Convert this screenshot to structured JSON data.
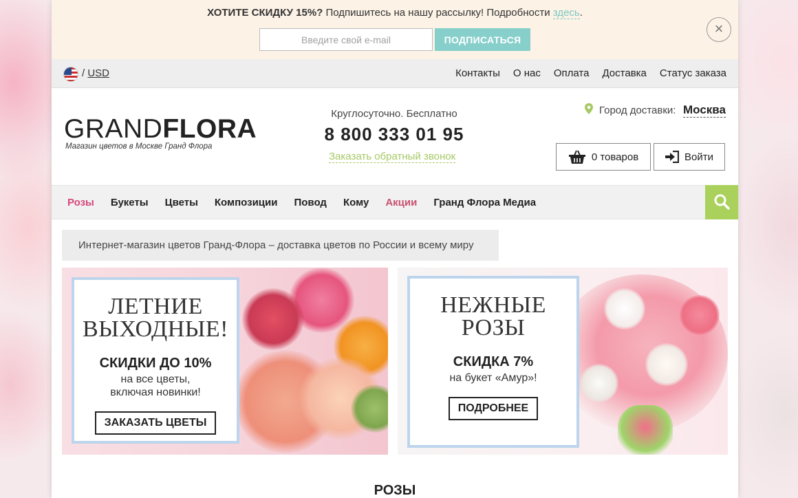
{
  "promo": {
    "lead": "ХОТИТЕ СКИДКУ 15%?",
    "text": "Подпишитесь на нашу рассылку! Подробности",
    "link": "здесь",
    "dot": ".",
    "email_placeholder": "Введите свой e-mail",
    "subscribe": "ПОДПИСАТЬСЯ",
    "close": "×"
  },
  "topbar": {
    "currency_sep": "/",
    "currency": "USD",
    "links": [
      "Контакты",
      "О нас",
      "Оплата",
      "Доставка",
      "Статус заказа"
    ]
  },
  "header": {
    "logo_light": "GRAND",
    "logo_bold": "FLORA",
    "tagline": "Магазин цветов в Москве Гранд Флора",
    "hours": "Круглосуточно. Бесплатно",
    "phone": "8 800 333 01 95",
    "callback": "Заказать обратный звонок",
    "city_label": "Город доставки:",
    "city": "Москва",
    "cart": "0 товаров",
    "login": "Войти"
  },
  "nav": {
    "items": [
      "Розы",
      "Букеты",
      "Цветы",
      "Композиции",
      "Повод",
      "Кому",
      "Акции",
      "Гранд Флора Медиа"
    ]
  },
  "breadcrumb": "Интернет-магазин цветов Гранд-Флора – доставка цветов по России и всему миру",
  "banners": [
    {
      "title_1": "ЛЕТНИЕ",
      "title_2": "ВЫХОДНЫЕ!",
      "subtitle": "СКИДКИ ДО 10%",
      "desc_1": "на все цветы,",
      "desc_2": "включая новинки!",
      "button": "ЗАКАЗАТЬ ЦВЕТЫ"
    },
    {
      "title_1": "НЕЖНЫЕ",
      "title_2": "РОЗЫ",
      "subtitle": "СКИДКА 7%",
      "desc_1": "на букет «Амур»!",
      "button": "ПОДРОБНЕЕ"
    }
  ],
  "section_title": "РОЗЫ",
  "colors": {
    "accent_teal": "#86cfcb",
    "accent_green": "#a9d15b",
    "accent_pink": "#d5477a",
    "promo_bg": "#fcf2e6"
  }
}
